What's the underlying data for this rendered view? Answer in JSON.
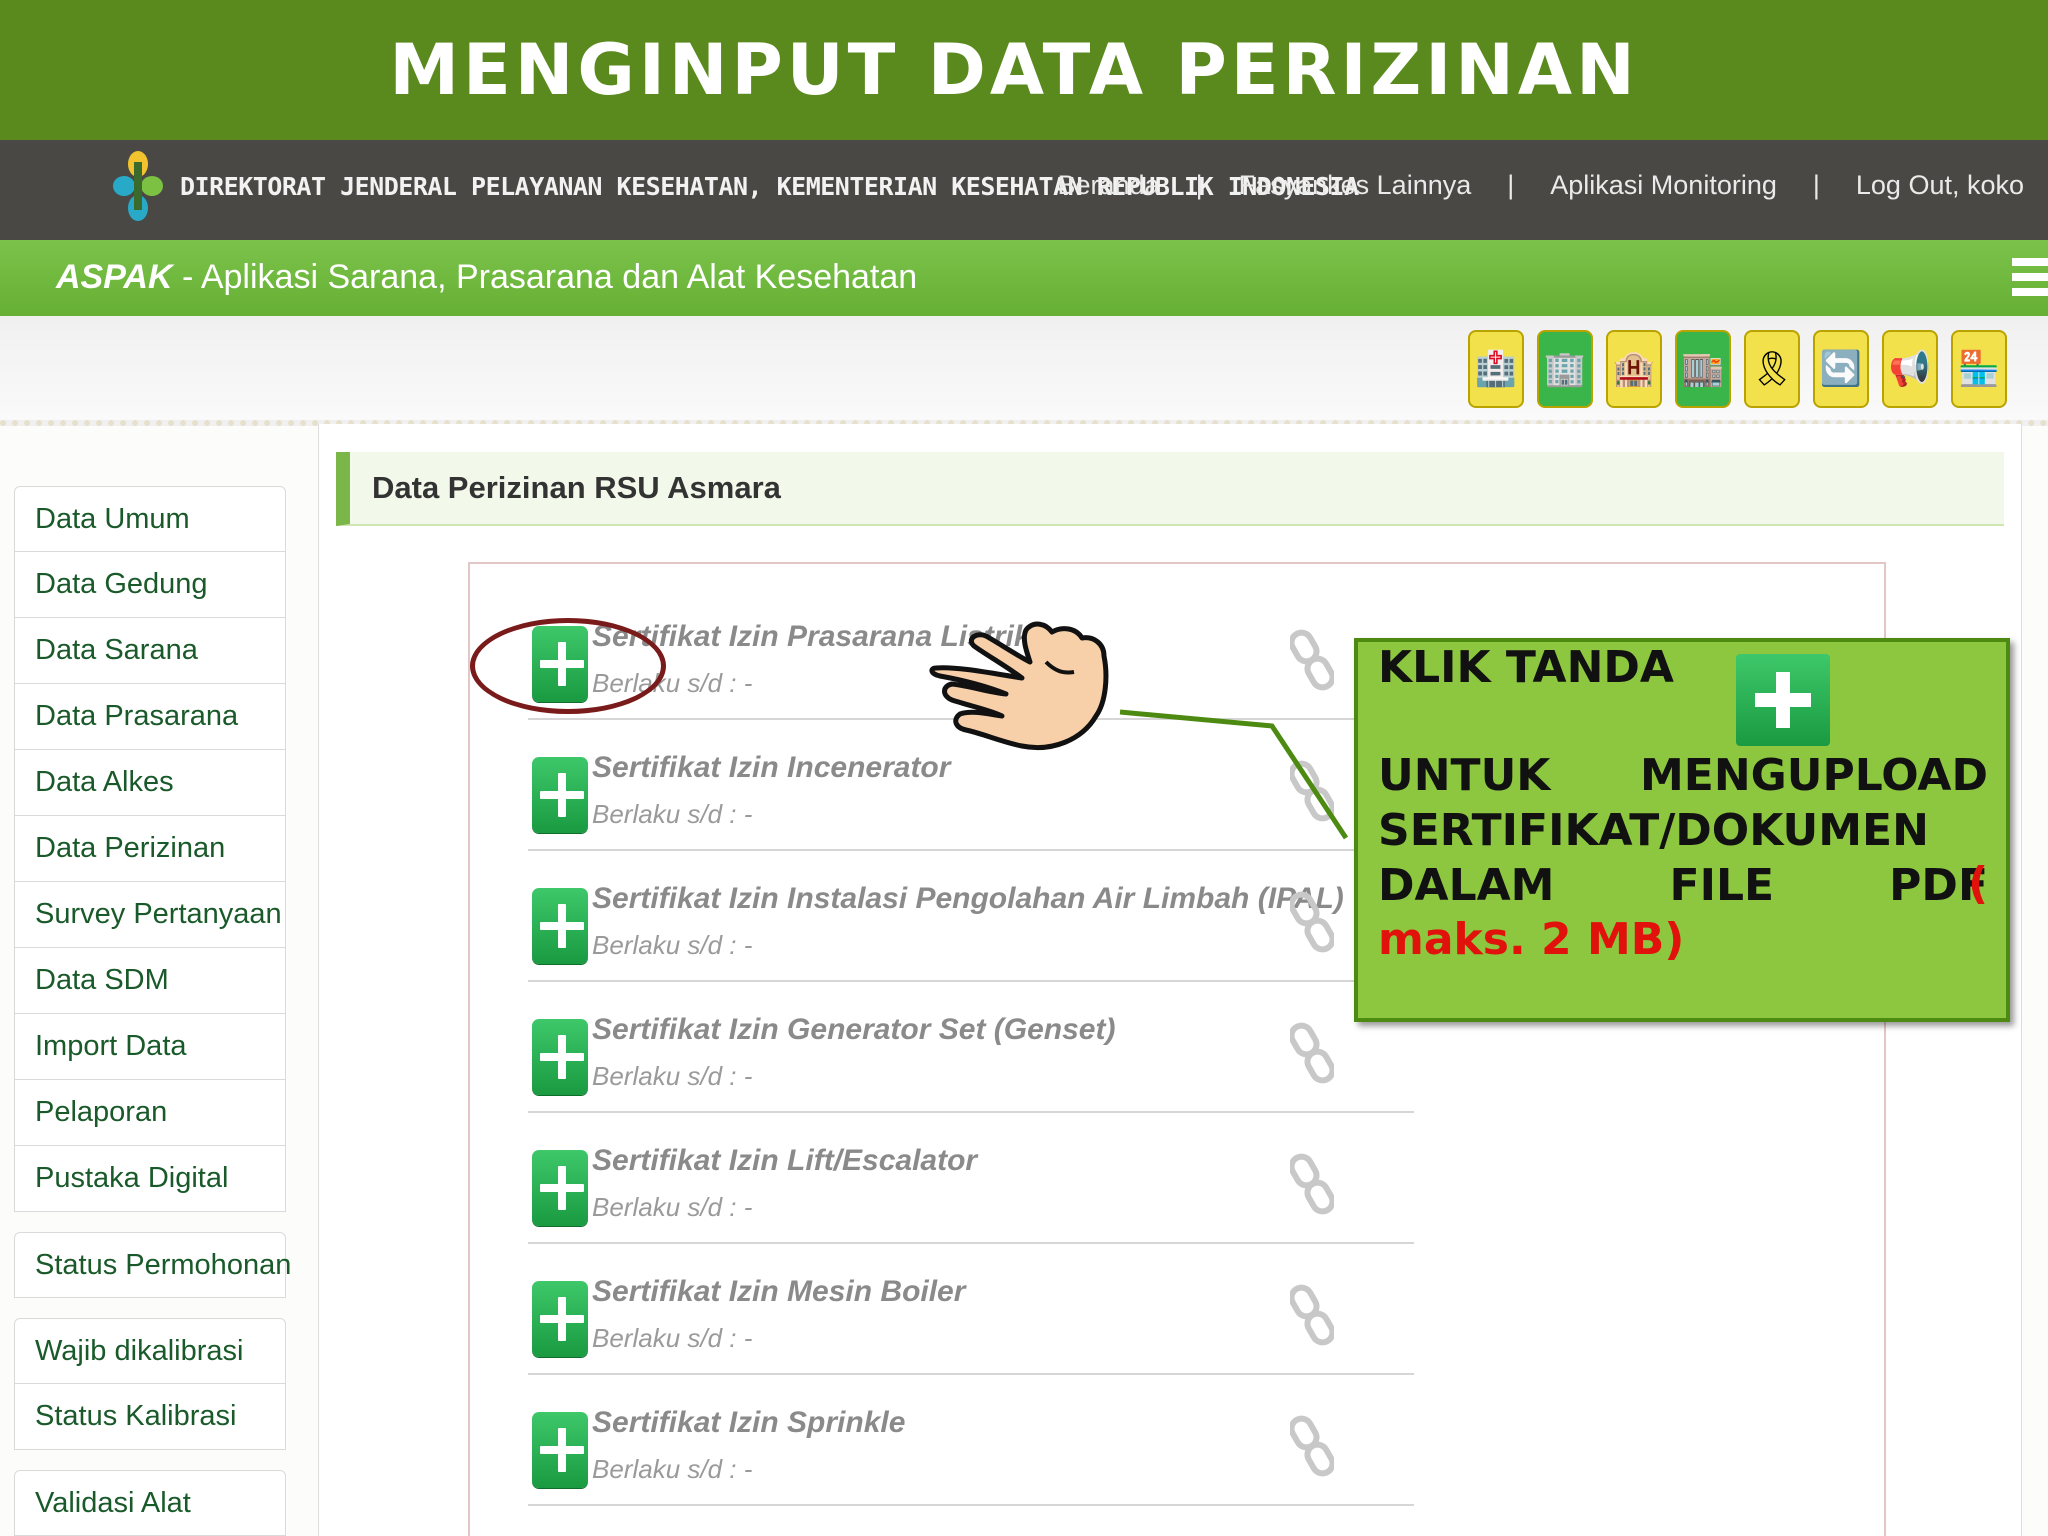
{
  "banner": {
    "title": "MENGINPUT DATA PERIZINAN"
  },
  "header": {
    "org_name": "DIREKTORAT JENDERAL PELAYANAN KESEHATAN, KEMENTERIAN KESEHATAN REPUBLIK INDONESIA",
    "nav": [
      {
        "label": "Beranda"
      },
      {
        "label": "Fasyankes Lainnya"
      },
      {
        "label": "Aplikasi Monitoring"
      },
      {
        "label": "Log Out, koko"
      }
    ],
    "separator": "|"
  },
  "appbar": {
    "brand": "ASPAK",
    "tagline": " - Aplikasi Sarana, Prasarana dan Alat Kesehatan"
  },
  "toolbar": {
    "tools": [
      {
        "icon": "hospital-building-icon",
        "glyph": "🏥",
        "bg": "#f2e14a"
      },
      {
        "icon": "clinic-building-icon",
        "glyph": "🏢",
        "bg": "#39b54a"
      },
      {
        "icon": "verified-building-icon",
        "glyph": "🏨",
        "bg": "#f2e14a"
      },
      {
        "icon": "verified-clinic-icon",
        "glyph": "🏬",
        "bg": "#39b54a"
      },
      {
        "icon": "award-ribbon-icon",
        "glyph": "🎗",
        "bg": "#f2e14a"
      },
      {
        "icon": "refresh-arrows-icon",
        "glyph": "🔄",
        "bg": "#f2e14a"
      },
      {
        "icon": "megaphone-icon",
        "glyph": "📢",
        "bg": "#f2e14a"
      },
      {
        "icon": "shop-building-icon",
        "glyph": "🏪",
        "bg": "#f2e14a"
      }
    ]
  },
  "sidebar": {
    "group1": [
      {
        "label": "Data Umum"
      },
      {
        "label": "Data Gedung"
      },
      {
        "label": "Data Sarana"
      },
      {
        "label": "Data Prasarana"
      },
      {
        "label": "Data Alkes"
      },
      {
        "label": "Data Perizinan"
      },
      {
        "label": "Survey Pertanyaan"
      },
      {
        "label": "Data SDM"
      },
      {
        "label": "Import Data"
      },
      {
        "label": "Pelaporan"
      },
      {
        "label": "Pustaka Digital"
      }
    ],
    "group2": [
      {
        "label": "Status Permohonan"
      }
    ],
    "group3": [
      {
        "label": "Wajib dikalibrasi"
      },
      {
        "label": "Status Kalibrasi"
      }
    ],
    "group4": [
      {
        "label": "Validasi Alat"
      }
    ]
  },
  "content": {
    "title": "Data Perizinan RSU Asmara",
    "items": [
      {
        "title": "Sertifikat Izin Prasarana Listrik",
        "sub": "Berlaku s/d : -"
      },
      {
        "title": "Sertifikat Izin Incenerator",
        "sub": "Berlaku s/d : -"
      },
      {
        "title": "Sertifikat Izin Instalasi Pengolahan Air Limbah (IPAL)",
        "sub": "Berlaku s/d : -"
      },
      {
        "title": "Sertifikat Izin Generator Set (Genset)",
        "sub": "Berlaku s/d : -"
      },
      {
        "title": "Sertifikat Izin Lift/Escalator",
        "sub": "Berlaku s/d : -"
      },
      {
        "title": "Sertifikat Izin Mesin Boiler",
        "sub": "Berlaku s/d : -"
      },
      {
        "title": "Sertifikat Izin Sprinkle",
        "sub": "Berlaku s/d : -"
      }
    ]
  },
  "callout": {
    "head": "KLIK TANDA",
    "body": "UNTUK MENGUPLOAD SERTIFIKAT/DOKUMEN DALAM FILE PDF",
    "red_open": "(",
    "red": "maks. 2 MB)"
  },
  "colors": {
    "banner": "#5a8a1e",
    "topbar": "#4a4844",
    "appbar": "#6cb63a",
    "accent_green": "#1a9a41",
    "callout_bg": "#8dc63f",
    "highlight_red": "#e0120b"
  }
}
